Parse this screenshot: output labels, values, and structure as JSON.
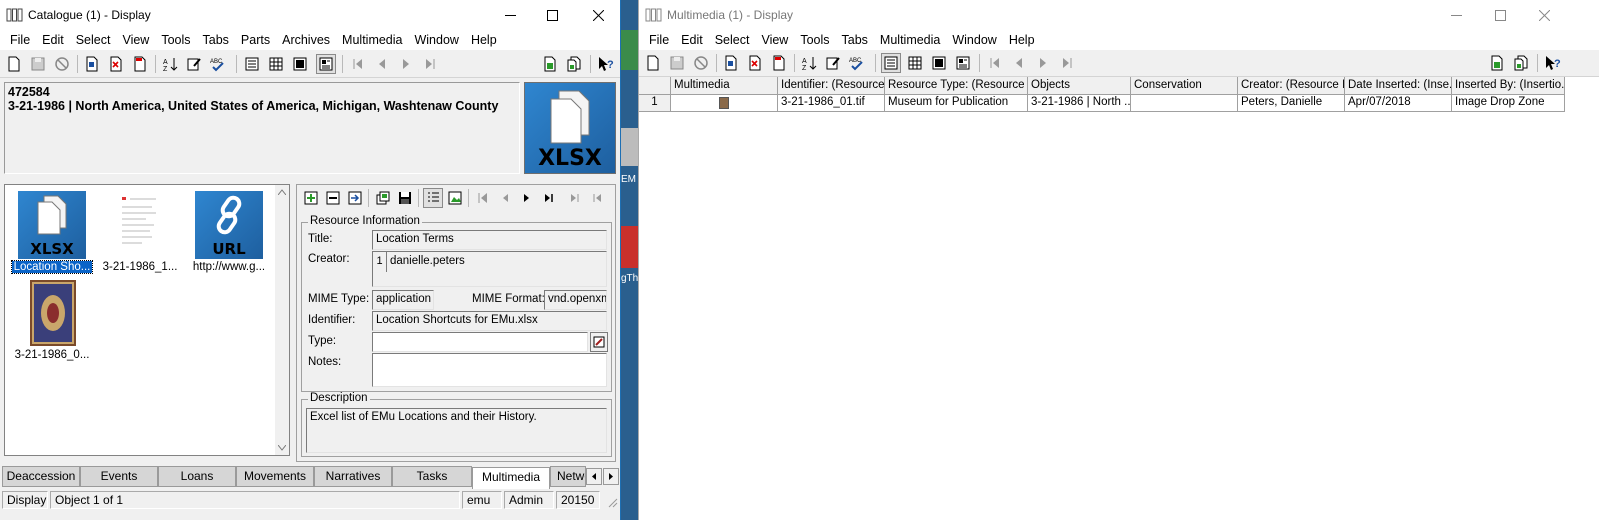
{
  "catalogue": {
    "title": "Catalogue (1) - Display",
    "menu": [
      "File",
      "Edit",
      "Select",
      "View",
      "Tools",
      "Tabs",
      "Parts",
      "Archives",
      "Multimedia",
      "Window",
      "Help"
    ],
    "header_id": "472584",
    "header_summary": "3-21-1986 | North America, United States of America, Michigan, Washtenaw County",
    "thumb_label": "XLSX",
    "gallery": [
      {
        "badge": "XLSX",
        "caption": "Location Sho..."
      },
      {
        "badge": "",
        "caption": "3-21-1986_1..."
      },
      {
        "badge": "URL",
        "caption": "http://www.g..."
      },
      {
        "badge": "",
        "caption": "3-21-1986_0..."
      }
    ],
    "resource": {
      "legend": "Resource Information",
      "title_label": "Title:",
      "title_value": "Location Terms",
      "creator_label": "Creator:",
      "creator_index": "1",
      "creator_value": "danielle.peters",
      "mime_type_label": "MIME Type:",
      "mime_type_value": "application",
      "mime_format_label": "MIME Format:",
      "mime_format_value": "vnd.openxml",
      "identifier_label": "Identifier:",
      "identifier_value": "Location Shortcuts for EMu.xlsx",
      "type_label": "Type:",
      "type_value": "",
      "notes_label": "Notes:",
      "notes_value": ""
    },
    "description": {
      "legend": "Description",
      "value": "Excel list of EMu Locations and their History."
    },
    "tabs": [
      "Deaccession",
      "Events",
      "Loans",
      "Movements",
      "Narratives",
      "Tasks",
      "Multimedia",
      "Netwo"
    ],
    "active_tab": "Multimedia",
    "status": {
      "mode": "Display",
      "position": "Object 1 of 1",
      "user": "emu",
      "role": "Admin",
      "port": "20150"
    }
  },
  "background": {
    "fragments": [
      "EM",
      "gTh"
    ]
  },
  "multimedia": {
    "title": "Multimedia (1) - Display",
    "menu": [
      "File",
      "Edit",
      "Select",
      "View",
      "Tools",
      "Tabs",
      "Multimedia",
      "Window",
      "Help"
    ],
    "columns": [
      "Multimedia",
      "Identifier: (Resource...",
      "Resource Type: (Resource ...",
      "Objects",
      "Conservation",
      "Creator: (Resource I...",
      "Date Inserted: (Inse...",
      "Inserted By: (Insertio..."
    ],
    "rows": [
      {
        "num": "1",
        "multimedia": "",
        "identifier": "3-21-1986_01.tif",
        "resource_type": "Museum for Publication",
        "objects": "3-21-1986 | North ...",
        "conservation": "",
        "creator": "Peters, Danielle",
        "date_inserted": "Apr/07/2018",
        "inserted_by": "Image Drop Zone"
      }
    ]
  },
  "colors": {
    "desktop": "#1d6fb3",
    "selection": "#0a64c8",
    "window_bg": "#f0f0f0"
  }
}
